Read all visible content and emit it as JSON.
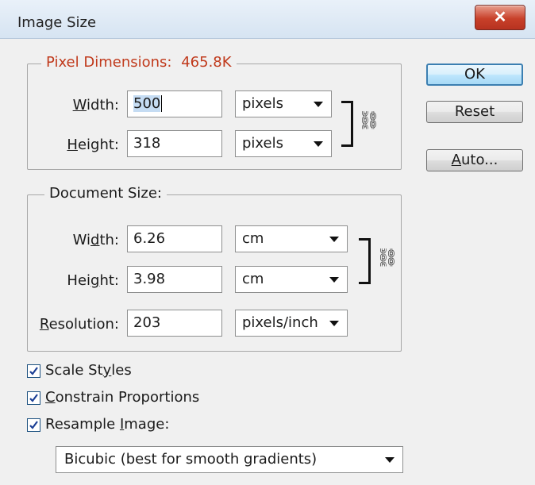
{
  "window": {
    "title": "Image Size"
  },
  "pixel_dimensions": {
    "legend_prefix": "Pixel Dimensions:",
    "size": "465.8K",
    "width_label": "Width:",
    "width_value": "500",
    "width_unit": "pixels",
    "height_label": "Height:",
    "height_value": "318",
    "height_unit": "pixels"
  },
  "document_size": {
    "legend": "Document Size:",
    "width_label": "Width:",
    "width_value": "6.26",
    "width_unit": "cm",
    "height_label": "Height:",
    "height_value": "3.98",
    "height_unit": "cm",
    "resolution_label": "Resolution:",
    "resolution_value": "203",
    "resolution_unit": "pixels/inch"
  },
  "options": {
    "scale_styles": {
      "label": "Scale Styles",
      "checked": true
    },
    "constrain_proportions": {
      "label": "Constrain Proportions",
      "checked": true
    },
    "resample_image": {
      "label": "Resample Image:",
      "checked": true
    },
    "resample_method": "Bicubic (best for smooth gradients)"
  },
  "buttons": {
    "ok": "OK",
    "reset": "Reset",
    "auto": "Auto..."
  },
  "colors": {
    "legend_accent": "#c0391b",
    "close_button": "#c8402a",
    "default_button_border": "#3c7fb1"
  }
}
